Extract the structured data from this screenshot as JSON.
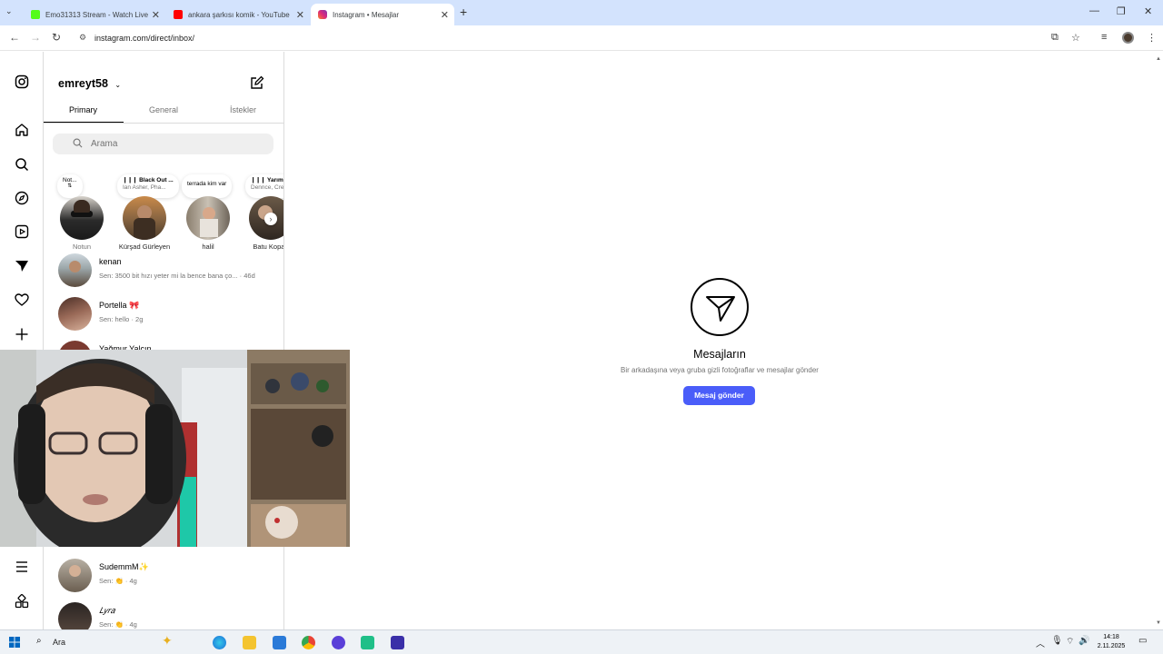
{
  "browser": {
    "tabs": [
      {
        "title": "Emo31313 Stream - Watch Live",
        "favicon_color": "#53fc18"
      },
      {
        "title": "ankara şarkısı komik - YouTube",
        "favicon_color": "#ff0000"
      },
      {
        "title": "Instagram • Mesajlar",
        "favicon_color": "#e1306c",
        "active": true
      }
    ],
    "url": "instagram.com/direct/inbox/"
  },
  "inbox": {
    "username": "emreyt58",
    "tabs": [
      "Primary",
      "General",
      "İstekler"
    ],
    "search_placeholder": "Arama",
    "stories": [
      {
        "note": "Not...",
        "note_sub": "",
        "name": "Notun"
      },
      {
        "note": "❙❙❙ Black Out ...",
        "note_sub": "Ian Asher, Pha...",
        "name": "Kürşad Gürleyen"
      },
      {
        "note": "terrada kim var",
        "note_sub": "",
        "name": "halil"
      },
      {
        "note": "❙❙❙ Yarım kal...",
        "note_sub": "Dennce, Cre...",
        "name": "Batu Kopan"
      }
    ],
    "conversations": [
      {
        "name": "kenan",
        "preview": "Sen: 3500 bit hızı yeter mi la bence bana ço... · 46d"
      },
      {
        "name": "Portella 🎀",
        "preview": "Sen: hello · 2g"
      },
      {
        "name": "Yağmur Yalçın",
        "preview": ""
      },
      {
        "name": "SudemmM✨",
        "preview": "Sen: 👏 · 4g"
      },
      {
        "name": "𝐿𝑦𝑟𝑎",
        "preview": "Sen: 👏 · 4g"
      }
    ]
  },
  "main": {
    "title": "Mesajların",
    "subtitle": "Bir arkadaşına veya gruba gizli fotoğraflar ve mesajlar gönder",
    "button": "Mesaj gönder",
    "accent": "#4a5df9"
  },
  "taskbar": {
    "search_label": "Ara",
    "time": "14:18",
    "date": "2.11.2025"
  }
}
